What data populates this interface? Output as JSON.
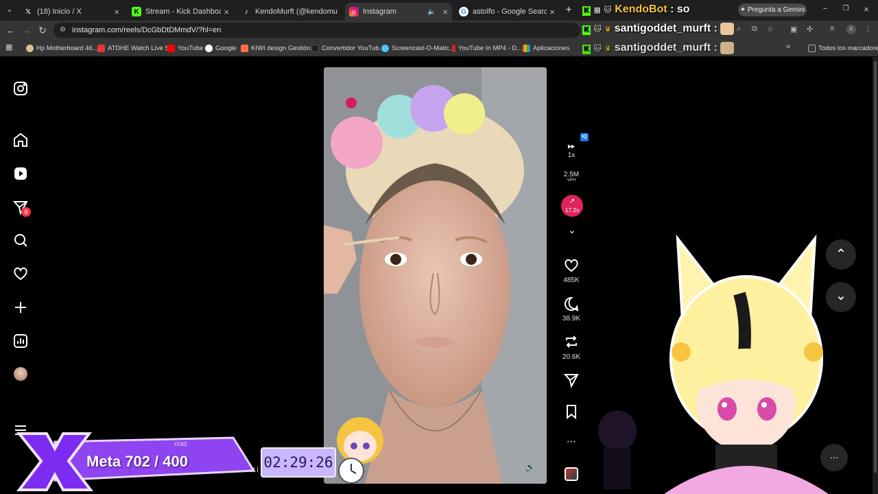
{
  "tabs": [
    {
      "label": "(18) Inicio / X",
      "favicon": "x-logo-icon"
    },
    {
      "label": "Stream - Kick Dashboard",
      "favicon": "kick-logo-icon"
    },
    {
      "label": "KendoMurft (@kendomurft) | T",
      "favicon": "tiktok-logo-icon"
    },
    {
      "label": "Instagram",
      "favicon": "instagram-logo-icon"
    },
    {
      "label": "astolfo - Google Search",
      "favicon": "google-logo-icon"
    }
  ],
  "address": {
    "url": "instagram.com/reels/DcGbDtDMmdV/?hl=en"
  },
  "gemini_button": "Pregunta a Gemini",
  "bookmarks": [
    "Hp Motherboard 46...",
    "ATDHE Watch Live S...",
    "YouTube",
    "Google",
    "KIWI design Gestión...",
    "Convertidor YouTub...",
    "Screencast-O-Matic...",
    "YouTube In MP4 - D...",
    "Aplicaciones"
  ],
  "bookmarks_folder": "Todos los marcadores",
  "sidebar": {
    "notification_badge": "8"
  },
  "rail": {
    "speed": "1x",
    "vph_value": "2.5M",
    "vph_label": "VPH",
    "trend": "17.2x",
    "iq_badge": "IQ",
    "likes": "485K",
    "comments": "38.9K",
    "reposts": "20.6K"
  },
  "chat": [
    {
      "user": "KendoBot",
      "message": "so"
    },
    {
      "user": "santigoddet_murft",
      "message": ""
    },
    {
      "user": "santigoddet_murft",
      "message": ""
    }
  ],
  "stream_overlay": {
    "goal": "Meta 702 / 400",
    "timer": "02:29:26",
    "partial_name": "craz",
    "partial_text": "st l"
  },
  "colors": {
    "accent_pink": "#e0245e",
    "kick_green": "#53fc18",
    "goal_purple": "#8e44f0",
    "timer_bg": "#c9b6ff"
  }
}
